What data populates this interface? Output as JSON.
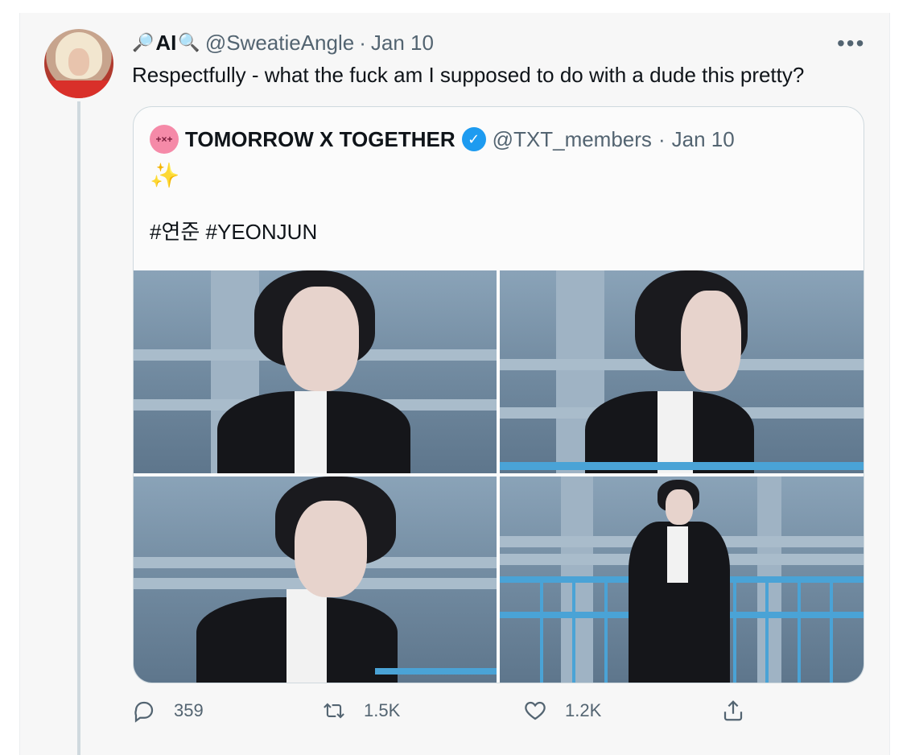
{
  "tweet": {
    "display_name": "AI",
    "handle": "@SweatieAngle",
    "separator": "·",
    "date": "Jan 10",
    "more_icon": "more-horizontal-icon",
    "text": "Respectfully - what the fuck am I supposed to do with a dude this pretty?"
  },
  "quote": {
    "avatar_text": "+×+",
    "name": "TOMORROW X TOGETHER",
    "verified_icon": "verified-badge-icon",
    "handle": "@TXT_members",
    "separator": "·",
    "date": "Jan 10",
    "emoji": "✨",
    "hashtags": "#연준 #YEONJUN",
    "photos": [
      {
        "name": "photo-1"
      },
      {
        "name": "photo-2"
      },
      {
        "name": "photo-3"
      },
      {
        "name": "photo-4"
      }
    ]
  },
  "actions": {
    "reply_count": "359",
    "retweet_count": "1.5K",
    "like_count": "1.2K",
    "icons": [
      "reply-icon",
      "retweet-icon",
      "like-icon",
      "share-icon"
    ]
  },
  "colors": {
    "secondary_text": "#536471",
    "verified": "#1d9bf0",
    "border": "#cfd9de"
  }
}
